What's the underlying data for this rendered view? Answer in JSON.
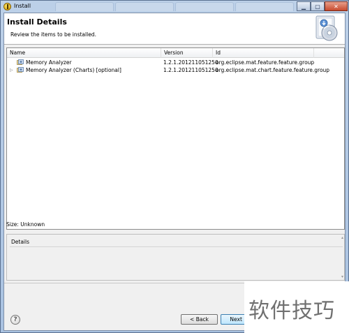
{
  "window": {
    "title": "Install"
  },
  "header": {
    "title": "Install Details",
    "description": "Review the items to be installed."
  },
  "table": {
    "columns": [
      "Name",
      "Version",
      "Id"
    ],
    "rows": [
      {
        "name": "Memory Analyzer",
        "version": "1.2.1.201211051250",
        "id": "org.eclipse.mat.feature.feature.group",
        "expandable": false
      },
      {
        "name": "Memory Analyzer (Charts) [optional]",
        "version": "1.2.1.201211051250",
        "id": "org.eclipse.mat.chart.feature.feature.group",
        "expandable": true
      }
    ]
  },
  "size": {
    "label": "Size: Unknown"
  },
  "details": {
    "label": "Details"
  },
  "buttons": {
    "back": "< Back",
    "next": "Next >",
    "help": "?"
  },
  "watermark": {
    "text": "软件技巧"
  },
  "colors": {
    "accent": "#3c7fb1",
    "frame": "#a9c2e1"
  }
}
